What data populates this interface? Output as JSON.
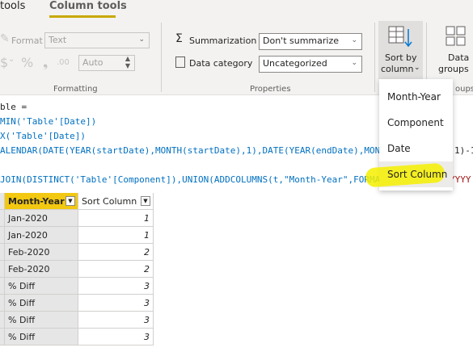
{
  "tabs": {
    "left": "tools",
    "active": "Column tools"
  },
  "formatting": {
    "format_label": "Format",
    "format_value": "Text",
    "auto_value": "Auto",
    "group_label": "Formatting"
  },
  "properties": {
    "summarization_label": "Summarization",
    "summarization_value": "Don't summarize",
    "category_label": "Data category",
    "category_value": "Uncategorized",
    "group_label": "Properties"
  },
  "sort": {
    "line1": "Sort by",
    "line2": "column"
  },
  "data_groups": {
    "line1": "Data",
    "line2": "groups",
    "group_label": "oups"
  },
  "formula": {
    "lines": [
      "ble =",
      "MIN('Table'[Date])",
      "X('Table'[Date])",
      "ALENDAR(DATE(YEAR(startDate),MONTH(startDate),1),DATE(YEAR(endDate),MON",
      "1)-1",
      "JOIN(DISTINCT('Table'[Component]),UNION(ADDCOLUMNS(t,\"Month-Year\",FORMA",
      "YYYY"
    ]
  },
  "sort_menu": {
    "items": [
      "Month-Year",
      "Component",
      "Date",
      "Sort Column"
    ]
  },
  "table": {
    "headers": [
      "Month-Year",
      "Sort Column"
    ],
    "rows": [
      [
        "Jan-2020",
        "1"
      ],
      [
        "Jan-2020",
        "1"
      ],
      [
        "Feb-2020",
        "2"
      ],
      [
        "Feb-2020",
        "2"
      ],
      [
        "% Diff",
        "3"
      ],
      [
        "% Diff",
        "3"
      ],
      [
        "% Diff",
        "3"
      ],
      [
        "% Diff",
        "3"
      ]
    ]
  }
}
